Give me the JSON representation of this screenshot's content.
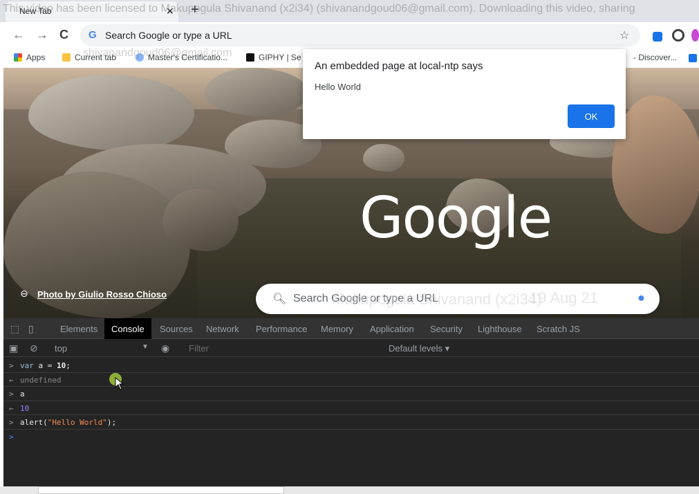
{
  "tab": {
    "title": "New Tab",
    "close_label": "✕",
    "newtab_label": "+"
  },
  "watermark": {
    "top": "This video has been licensed to Makupogula Shivanand (x2i34) (shivanandgoud06@gmail.com). Downloading this video, sharing",
    "middle": "Makupogula Shivanand (x2i34)",
    "date": "19 Aug 21",
    "bookmark_overlay": "shivanandgoud06@gmail.com"
  },
  "toolbar": {
    "back_label": "←",
    "forward_label": "→",
    "reload_label": "C",
    "omnibox_placeholder": "Search Google or type a URL",
    "omnibox_icon": "G",
    "star_label": "☆"
  },
  "bookmarks": {
    "apps": "Apps",
    "current_tab": "Current tab",
    "masters": "Master's Certificatio...",
    "giphy": "GIPHY | Se",
    "discover": "- Discover..."
  },
  "ntp": {
    "logo": "Google",
    "photo_credit": "Photo by Giulio Rosso Chioso",
    "search_placeholder": "Search Google or type a URL"
  },
  "dialog": {
    "title": "An embedded page at local-ntp says",
    "message": "Hello World",
    "ok_label": "OK"
  },
  "devtools": {
    "tabs": [
      "Elements",
      "Console",
      "Sources",
      "Network",
      "Performance",
      "Memory",
      "Application",
      "Security",
      "Lighthouse",
      "Scratch JS"
    ],
    "active_tab": "Console",
    "context": "top",
    "filter_placeholder": "Filter",
    "levels": "Default levels ▾",
    "lines": [
      {
        "prompt": ">",
        "kind": "input",
        "text": "var a = 10;"
      },
      {
        "prompt": "←",
        "kind": "result-undef",
        "text": "undefined"
      },
      {
        "prompt": ">",
        "kind": "input",
        "text": "a"
      },
      {
        "prompt": "←",
        "kind": "result-num",
        "text": "10"
      },
      {
        "prompt": ">",
        "kind": "input",
        "text": "alert(\"Hello World\");"
      },
      {
        "prompt": ">",
        "kind": "active",
        "text": ""
      }
    ]
  },
  "colors": {
    "accent": "#1a73e8",
    "devtools_bg": "#242424"
  }
}
